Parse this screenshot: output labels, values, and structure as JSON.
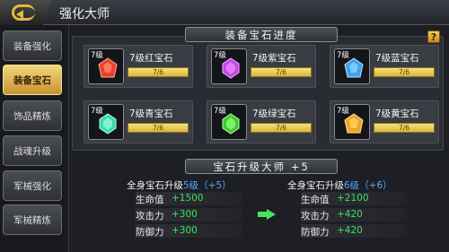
{
  "header": {
    "title": "强化大师",
    "back_icon": "back-arrow-icon"
  },
  "sidebar": {
    "items": [
      {
        "label": "装备强化",
        "active": false
      },
      {
        "label": "装备宝石",
        "active": true
      },
      {
        "label": "饰品精炼",
        "active": false
      },
      {
        "label": "战魂升级",
        "active": false
      },
      {
        "label": "军械强化",
        "active": false
      },
      {
        "label": "军械精炼",
        "active": false
      }
    ]
  },
  "progress": {
    "title": "装备宝石进度",
    "help": "?",
    "gems": [
      {
        "level": "7级",
        "name": "7级红宝石",
        "progress": "7/6",
        "color": "#e8412b"
      },
      {
        "level": "7级",
        "name": "7级紫宝石",
        "progress": "7/6",
        "color": "#c447e6"
      },
      {
        "level": "7级",
        "name": "7级蓝宝石",
        "progress": "7/6",
        "color": "#3fa2f0"
      },
      {
        "level": "7级",
        "name": "7级青宝石",
        "progress": "7/6",
        "color": "#3fd6b0"
      },
      {
        "level": "7级",
        "name": "7级绿宝石",
        "progress": "7/6",
        "color": "#3ecb2c"
      },
      {
        "level": "7级",
        "name": "7级黄宝石",
        "progress": "7/6",
        "color": "#f4a424"
      }
    ]
  },
  "master": {
    "title": "宝石升级大师 +5",
    "current": {
      "prefix": "全身宝石升级",
      "level": "5级",
      "bonus": "（+5）",
      "stats": [
        {
          "label": "生命值",
          "value": "+1500"
        },
        {
          "label": "攻击力",
          "value": "+300"
        },
        {
          "label": "防御力",
          "value": "+300"
        }
      ]
    },
    "next": {
      "prefix": "全身宝石升级",
      "level": "6级",
      "bonus": "（+6）",
      "stats": [
        {
          "label": "生命值",
          "value": "+2100"
        },
        {
          "label": "攻击力",
          "value": "+420"
        },
        {
          "label": "防御力",
          "value": "+420"
        }
      ]
    }
  },
  "colors": {
    "accent": "#e3b843",
    "stat_green": "#3ee15a",
    "level_blue": "#4fa8ff"
  }
}
